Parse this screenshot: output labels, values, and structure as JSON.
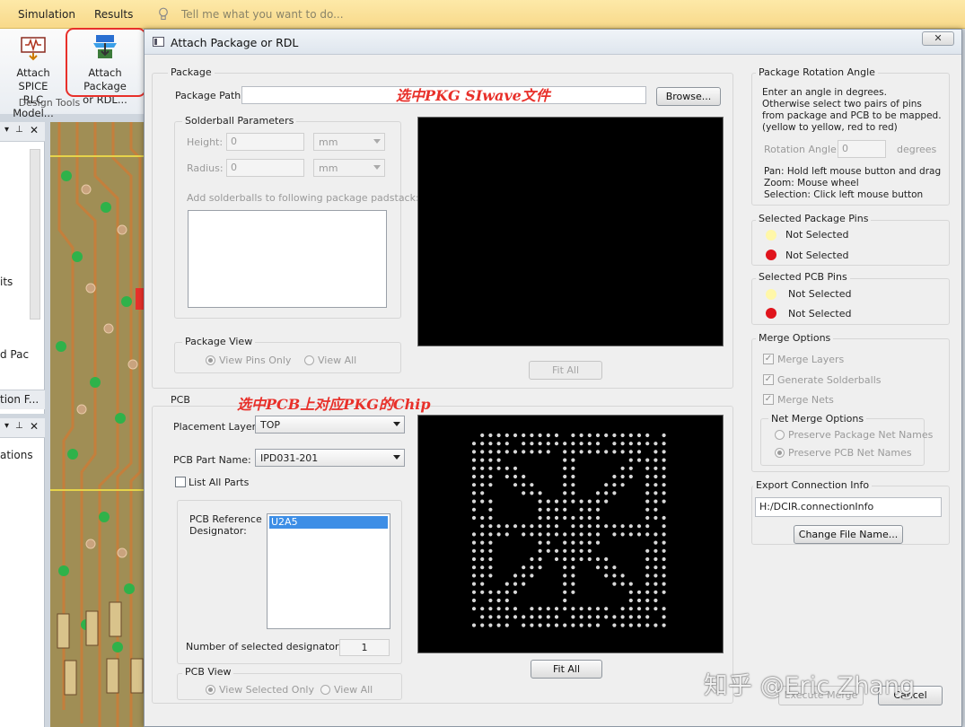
{
  "ribbon": {
    "tabs": [
      "Simulation",
      "Results"
    ],
    "tell_me_placeholder": "Tell me what you want to do...",
    "buttons": [
      {
        "label_line1": "Attach SPICE",
        "label_line2": "RLC Model...",
        "icon": "spice-model-icon"
      },
      {
        "label_line1": "Attach Package",
        "label_line2": "or RDL...",
        "icon": "attach-package-icon"
      }
    ],
    "group_label": "Design Tools"
  },
  "left_panels": {
    "panel1_texts": [
      "its",
      "d Pac",
      "tion F..."
    ],
    "panel2_texts": [
      "ations"
    ]
  },
  "dialog": {
    "title": "Attach Package or RDL",
    "close_icon": "close-icon",
    "package": {
      "group_label": "Package",
      "path_label": "Package Path:",
      "path_value": "",
      "browse_label": "Browse...",
      "annotation": "选中PKG SIwave文件",
      "solderball": {
        "group_label": "Solderball Parameters",
        "height_label": "Height:",
        "height_value": "0",
        "height_unit": "mm",
        "radius_label": "Radius:",
        "radius_value": "0",
        "radius_unit": "mm",
        "padstack_label": "Add solderballs to following package padstack:"
      },
      "view": {
        "group_label": "Package View",
        "pins_only": "View Pins Only",
        "view_all": "View All"
      },
      "fit_all": "Fit All"
    },
    "pcb": {
      "group_label": "PCB",
      "annotation": "选中PCB上对应PKG的Chip",
      "placement_layer_label": "Placement Layer:",
      "placement_layer_value": "TOP",
      "part_name_label": "PCB Part Name:",
      "part_name_value": "IPD031-201",
      "list_all_parts": "List All Parts",
      "ref_designator_label_1": "PCB Reference",
      "ref_designator_label_2": "Designator:",
      "ref_designators": [
        "U2A5"
      ],
      "num_selected_label": "Number of selected designators:",
      "num_selected_value": "1",
      "view": {
        "group_label": "PCB View",
        "selected_only": "View Selected Only",
        "view_all": "View All"
      },
      "fit_all": "Fit All"
    },
    "rotation": {
      "group_label": "Package Rotation Angle",
      "instructions": [
        "Enter an angle in degrees.",
        "Otherwise select two pairs of pins",
        "from package and PCB to be mapped.",
        "(yellow to yellow, red to red)"
      ],
      "angle_label": "Rotation Angle:",
      "angle_value": "0",
      "angle_unit": "degrees",
      "help": [
        "Pan: Hold left mouse button and drag",
        "Zoom: Mouse wheel",
        "Selection: Click left mouse button"
      ]
    },
    "selected_package_pins": {
      "group_label": "Selected Package Pins",
      "yellow": "Not Selected",
      "red": "Not Selected"
    },
    "selected_pcb_pins": {
      "group_label": "Selected PCB Pins",
      "yellow": "Not Selected",
      "red": "Not Selected"
    },
    "merge": {
      "group_label": "Merge Options",
      "merge_layers": "Merge Layers",
      "generate_solderballs": "Generate Solderballs",
      "merge_nets": "Merge Nets",
      "net_merge_label": "Net Merge Options",
      "preserve_package": "Preserve Package Net Names",
      "preserve_pcb": "Preserve PCB Net Names"
    },
    "export": {
      "group_label": "Export Connection Info",
      "path": "H:/DCIR.connectionInfo",
      "change_button": "Change File Name..."
    },
    "execute_merge": "Execute Merge",
    "cancel": "Cancel"
  },
  "colors": {
    "annotation_red": "#e8302a",
    "pin_yellow": "#fff7a8",
    "pin_red": "#e0141c",
    "selection_blue": "#3d8ee6"
  },
  "watermark": "知乎 @Eric Zhang"
}
